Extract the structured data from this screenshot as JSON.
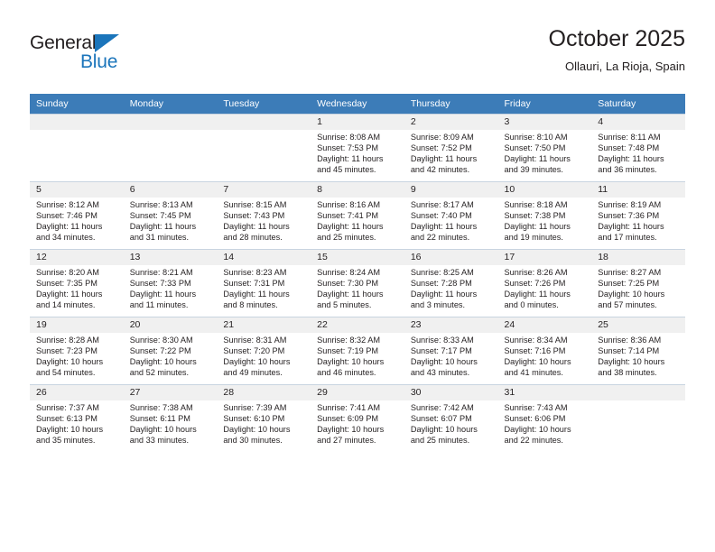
{
  "branding": {
    "logo_text_primary": "General",
    "logo_text_secondary": "Blue",
    "primary_color": "#1b75bb",
    "header_color": "#3c7cb8"
  },
  "header": {
    "title": "October 2025",
    "subtitle": "Ollauri, La Rioja, Spain"
  },
  "calendar": {
    "weekday_headers": [
      "Sunday",
      "Monday",
      "Tuesday",
      "Wednesday",
      "Thursday",
      "Friday",
      "Saturday"
    ],
    "weeks": [
      [
        {
          "day": "",
          "empty": true,
          "sunrise": "",
          "sunset": "",
          "daylight_line1": "",
          "daylight_line2": ""
        },
        {
          "day": "",
          "empty": true,
          "sunrise": "",
          "sunset": "",
          "daylight_line1": "",
          "daylight_line2": ""
        },
        {
          "day": "",
          "empty": true,
          "sunrise": "",
          "sunset": "",
          "daylight_line1": "",
          "daylight_line2": ""
        },
        {
          "day": "1",
          "empty": false,
          "sunrise": "Sunrise: 8:08 AM",
          "sunset": "Sunset: 7:53 PM",
          "daylight_line1": "Daylight: 11 hours",
          "daylight_line2": "and 45 minutes."
        },
        {
          "day": "2",
          "empty": false,
          "sunrise": "Sunrise: 8:09 AM",
          "sunset": "Sunset: 7:52 PM",
          "daylight_line1": "Daylight: 11 hours",
          "daylight_line2": "and 42 minutes."
        },
        {
          "day": "3",
          "empty": false,
          "sunrise": "Sunrise: 8:10 AM",
          "sunset": "Sunset: 7:50 PM",
          "daylight_line1": "Daylight: 11 hours",
          "daylight_line2": "and 39 minutes."
        },
        {
          "day": "4",
          "empty": false,
          "sunrise": "Sunrise: 8:11 AM",
          "sunset": "Sunset: 7:48 PM",
          "daylight_line1": "Daylight: 11 hours",
          "daylight_line2": "and 36 minutes."
        }
      ],
      [
        {
          "day": "5",
          "empty": false,
          "sunrise": "Sunrise: 8:12 AM",
          "sunset": "Sunset: 7:46 PM",
          "daylight_line1": "Daylight: 11 hours",
          "daylight_line2": "and 34 minutes."
        },
        {
          "day": "6",
          "empty": false,
          "sunrise": "Sunrise: 8:13 AM",
          "sunset": "Sunset: 7:45 PM",
          "daylight_line1": "Daylight: 11 hours",
          "daylight_line2": "and 31 minutes."
        },
        {
          "day": "7",
          "empty": false,
          "sunrise": "Sunrise: 8:15 AM",
          "sunset": "Sunset: 7:43 PM",
          "daylight_line1": "Daylight: 11 hours",
          "daylight_line2": "and 28 minutes."
        },
        {
          "day": "8",
          "empty": false,
          "sunrise": "Sunrise: 8:16 AM",
          "sunset": "Sunset: 7:41 PM",
          "daylight_line1": "Daylight: 11 hours",
          "daylight_line2": "and 25 minutes."
        },
        {
          "day": "9",
          "empty": false,
          "sunrise": "Sunrise: 8:17 AM",
          "sunset": "Sunset: 7:40 PM",
          "daylight_line1": "Daylight: 11 hours",
          "daylight_line2": "and 22 minutes."
        },
        {
          "day": "10",
          "empty": false,
          "sunrise": "Sunrise: 8:18 AM",
          "sunset": "Sunset: 7:38 PM",
          "daylight_line1": "Daylight: 11 hours",
          "daylight_line2": "and 19 minutes."
        },
        {
          "day": "11",
          "empty": false,
          "sunrise": "Sunrise: 8:19 AM",
          "sunset": "Sunset: 7:36 PM",
          "daylight_line1": "Daylight: 11 hours",
          "daylight_line2": "and 17 minutes."
        }
      ],
      [
        {
          "day": "12",
          "empty": false,
          "sunrise": "Sunrise: 8:20 AM",
          "sunset": "Sunset: 7:35 PM",
          "daylight_line1": "Daylight: 11 hours",
          "daylight_line2": "and 14 minutes."
        },
        {
          "day": "13",
          "empty": false,
          "sunrise": "Sunrise: 8:21 AM",
          "sunset": "Sunset: 7:33 PM",
          "daylight_line1": "Daylight: 11 hours",
          "daylight_line2": "and 11 minutes."
        },
        {
          "day": "14",
          "empty": false,
          "sunrise": "Sunrise: 8:23 AM",
          "sunset": "Sunset: 7:31 PM",
          "daylight_line1": "Daylight: 11 hours",
          "daylight_line2": "and 8 minutes."
        },
        {
          "day": "15",
          "empty": false,
          "sunrise": "Sunrise: 8:24 AM",
          "sunset": "Sunset: 7:30 PM",
          "daylight_line1": "Daylight: 11 hours",
          "daylight_line2": "and 5 minutes."
        },
        {
          "day": "16",
          "empty": false,
          "sunrise": "Sunrise: 8:25 AM",
          "sunset": "Sunset: 7:28 PM",
          "daylight_line1": "Daylight: 11 hours",
          "daylight_line2": "and 3 minutes."
        },
        {
          "day": "17",
          "empty": false,
          "sunrise": "Sunrise: 8:26 AM",
          "sunset": "Sunset: 7:26 PM",
          "daylight_line1": "Daylight: 11 hours",
          "daylight_line2": "and 0 minutes."
        },
        {
          "day": "18",
          "empty": false,
          "sunrise": "Sunrise: 8:27 AM",
          "sunset": "Sunset: 7:25 PM",
          "daylight_line1": "Daylight: 10 hours",
          "daylight_line2": "and 57 minutes."
        }
      ],
      [
        {
          "day": "19",
          "empty": false,
          "sunrise": "Sunrise: 8:28 AM",
          "sunset": "Sunset: 7:23 PM",
          "daylight_line1": "Daylight: 10 hours",
          "daylight_line2": "and 54 minutes."
        },
        {
          "day": "20",
          "empty": false,
          "sunrise": "Sunrise: 8:30 AM",
          "sunset": "Sunset: 7:22 PM",
          "daylight_line1": "Daylight: 10 hours",
          "daylight_line2": "and 52 minutes."
        },
        {
          "day": "21",
          "empty": false,
          "sunrise": "Sunrise: 8:31 AM",
          "sunset": "Sunset: 7:20 PM",
          "daylight_line1": "Daylight: 10 hours",
          "daylight_line2": "and 49 minutes."
        },
        {
          "day": "22",
          "empty": false,
          "sunrise": "Sunrise: 8:32 AM",
          "sunset": "Sunset: 7:19 PM",
          "daylight_line1": "Daylight: 10 hours",
          "daylight_line2": "and 46 minutes."
        },
        {
          "day": "23",
          "empty": false,
          "sunrise": "Sunrise: 8:33 AM",
          "sunset": "Sunset: 7:17 PM",
          "daylight_line1": "Daylight: 10 hours",
          "daylight_line2": "and 43 minutes."
        },
        {
          "day": "24",
          "empty": false,
          "sunrise": "Sunrise: 8:34 AM",
          "sunset": "Sunset: 7:16 PM",
          "daylight_line1": "Daylight: 10 hours",
          "daylight_line2": "and 41 minutes."
        },
        {
          "day": "25",
          "empty": false,
          "sunrise": "Sunrise: 8:36 AM",
          "sunset": "Sunset: 7:14 PM",
          "daylight_line1": "Daylight: 10 hours",
          "daylight_line2": "and 38 minutes."
        }
      ],
      [
        {
          "day": "26",
          "empty": false,
          "sunrise": "Sunrise: 7:37 AM",
          "sunset": "Sunset: 6:13 PM",
          "daylight_line1": "Daylight: 10 hours",
          "daylight_line2": "and 35 minutes."
        },
        {
          "day": "27",
          "empty": false,
          "sunrise": "Sunrise: 7:38 AM",
          "sunset": "Sunset: 6:11 PM",
          "daylight_line1": "Daylight: 10 hours",
          "daylight_line2": "and 33 minutes."
        },
        {
          "day": "28",
          "empty": false,
          "sunrise": "Sunrise: 7:39 AM",
          "sunset": "Sunset: 6:10 PM",
          "daylight_line1": "Daylight: 10 hours",
          "daylight_line2": "and 30 minutes."
        },
        {
          "day": "29",
          "empty": false,
          "sunrise": "Sunrise: 7:41 AM",
          "sunset": "Sunset: 6:09 PM",
          "daylight_line1": "Daylight: 10 hours",
          "daylight_line2": "and 27 minutes."
        },
        {
          "day": "30",
          "empty": false,
          "sunrise": "Sunrise: 7:42 AM",
          "sunset": "Sunset: 6:07 PM",
          "daylight_line1": "Daylight: 10 hours",
          "daylight_line2": "and 25 minutes."
        },
        {
          "day": "31",
          "empty": false,
          "sunrise": "Sunrise: 7:43 AM",
          "sunset": "Sunset: 6:06 PM",
          "daylight_line1": "Daylight: 10 hours",
          "daylight_line2": "and 22 minutes."
        },
        {
          "day": "",
          "empty": true,
          "sunrise": "",
          "sunset": "",
          "daylight_line1": "",
          "daylight_line2": ""
        }
      ]
    ]
  }
}
